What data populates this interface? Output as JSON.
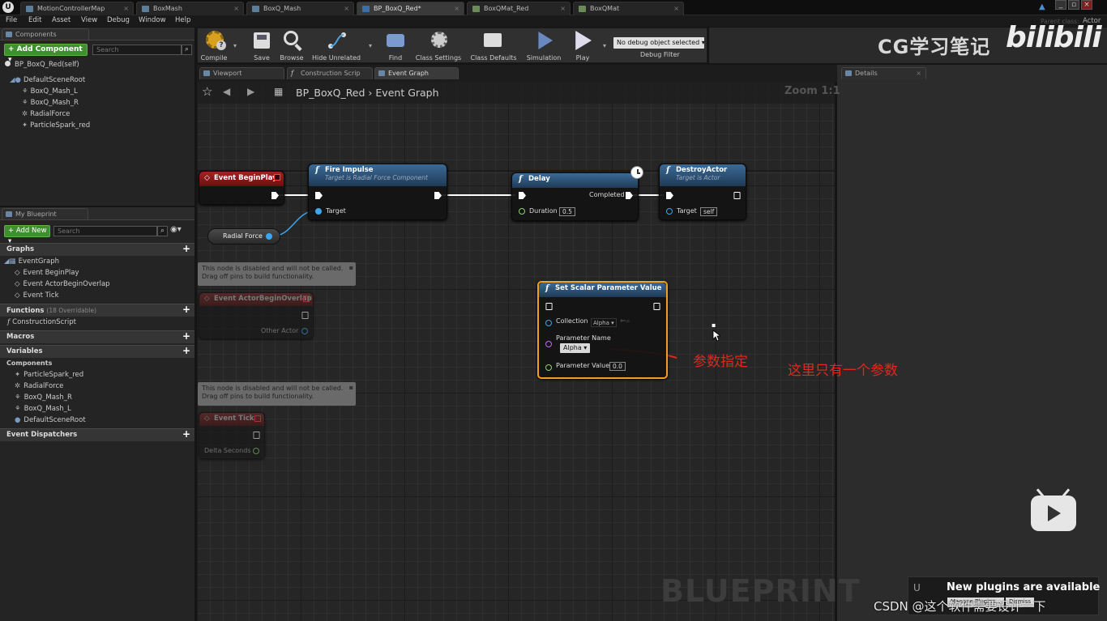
{
  "doc_tabs": [
    "MotionControllerMap",
    "BoxMash",
    "BoxQ_Mash",
    "BP_BoxQ_Red*",
    "BoxQMat_Red",
    "BoxQMat"
  ],
  "parent_class_label": "Parent class:",
  "parent_class_value": "Actor",
  "menu": [
    "File",
    "Edit",
    "Asset",
    "View",
    "Debug",
    "Window",
    "Help"
  ],
  "components": {
    "tab": "Components",
    "add_button": "+ Add Component ▾",
    "search_placeholder": "Search",
    "self_item": "BP_BoxQ_Red(self)",
    "tree": [
      "DefaultSceneRoot",
      "BoxQ_Mash_L",
      "BoxQ_Mash_R",
      "RadialForce",
      "ParticleSpark_red"
    ]
  },
  "my_blueprint": {
    "tab": "My Blueprint",
    "add_button": "+ Add New ▾",
    "search_placeholder": "Search",
    "graphs_label": "Graphs",
    "event_graph": "EventGraph",
    "events": [
      "Event BeginPlay",
      "Event ActorBeginOverlap",
      "Event Tick"
    ],
    "functions_label": "Functions",
    "functions_count": "(18 Overridable)",
    "functions": [
      "ConstructionScript"
    ],
    "macros_label": "Macros",
    "variables_label": "Variables",
    "components_label": "Components",
    "component_vars": [
      "ParticleSpark_red",
      "RadialForce",
      "BoxQ_Mash_R",
      "BoxQ_Mash_L",
      "DefaultSceneRoot"
    ],
    "dispatchers_label": "Event Dispatchers"
  },
  "toolbar": {
    "compile": "Compile",
    "save": "Save",
    "browse": "Browse",
    "hide_unrelated": "Hide Unrelated",
    "find": "Find",
    "class_settings": "Class Settings",
    "class_defaults": "Class Defaults",
    "simulation": "Simulation",
    "play": "Play",
    "debug_select": "No debug object selected ▾",
    "debug_filter": "Debug Filter"
  },
  "watermark_top": "CG学习笔记",
  "watermark_logo": "bilibili",
  "graph_tabs": [
    "Viewport",
    "Construction Scrip",
    "Event Graph"
  ],
  "details_tab": "Details",
  "breadcrumb": {
    "root": "BP_BoxQ_Red",
    "sep": "›",
    "leaf": "Event Graph"
  },
  "zoom": "Zoom 1:1",
  "nodes": {
    "begin_play": "Event BeginPlay",
    "fire_impulse": {
      "title": "Fire Impulse",
      "sub": "Target is Radial Force Component",
      "target": "Target"
    },
    "delay": {
      "title": "Delay",
      "completed": "Completed",
      "duration": "Duration",
      "duration_val": "0.5"
    },
    "destroy": {
      "title": "DestroyActor",
      "sub": "Target is Actor",
      "target": "Target",
      "target_val": "self"
    },
    "radial_force": "Radial Force",
    "disabled_note": "This node is disabled and will not be called. Drag off pins to build functionality.",
    "overlap": {
      "title": "Event ActorBeginOverlap",
      "other": "Other Actor"
    },
    "tick": {
      "title": "Event Tick",
      "delta": "Delta Seconds"
    },
    "set_scalar": {
      "title": "Set Scalar Parameter Value",
      "collection": "Collection",
      "collection_val": "Alpha ▾",
      "param_name": "Parameter Name",
      "param_val": "Alpha ▾",
      "param_value": "Parameter Value",
      "param_value_val": "0.0"
    }
  },
  "annotation_1": "参数指定",
  "annotation_2": "这里只有一个参数",
  "blueprint_watermark": "BLUEPRINT",
  "notification": {
    "title": "New plugins are available",
    "manage": "Manage Plugins...",
    "dismiss": "Dismiss"
  },
  "csdn": "CSDN @这个软件需要设计一下",
  "colors": {
    "event_red": "#9c1c1c",
    "function_blue": "#2d5d8a",
    "exec_white": "#ffffff",
    "object_pin": "#3aa7f0",
    "float_pin": "#8ed36e",
    "name_pin": "#c26bf0",
    "selected": "#f0a020",
    "annotation": "#e0281e"
  }
}
